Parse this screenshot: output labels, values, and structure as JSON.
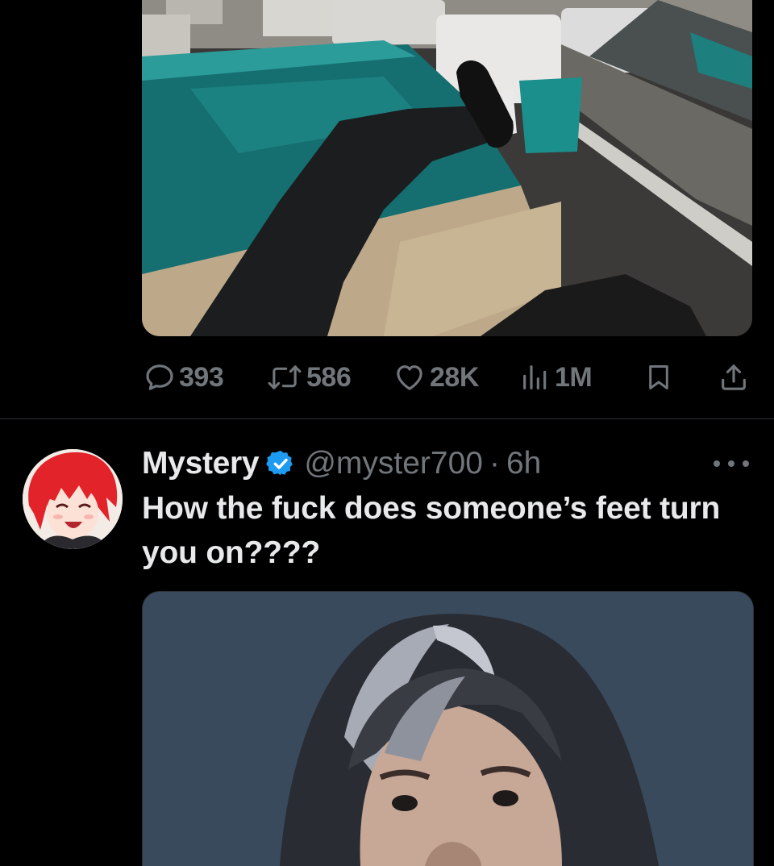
{
  "tweet_1": {
    "media": {
      "alt_icon": "photo"
    },
    "actions": {
      "reply_count": "393",
      "retweet_count": "586",
      "like_count": "28K",
      "view_count": "1M"
    }
  },
  "tweet_2": {
    "author_name": "Mystery",
    "verified": true,
    "handle": "@myster700",
    "separator": "·",
    "time": "6h",
    "text": "How the fuck does someone’s feet turn you on????"
  },
  "colors": {
    "background": "#000000",
    "text_primary": "#e7e9ea",
    "text_secondary": "#71767b",
    "divider": "#2f3336",
    "verified_blue": "#1d9bf0"
  }
}
